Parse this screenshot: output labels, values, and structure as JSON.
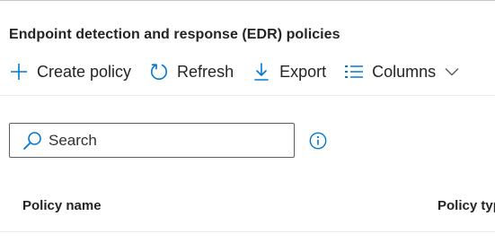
{
  "section": {
    "title": "Endpoint detection and response (EDR) policies"
  },
  "toolbar": {
    "create_label": "Create policy",
    "create_icon": "add-icon",
    "refresh_label": "Refresh",
    "refresh_icon": "refresh-icon",
    "export_label": "Export",
    "export_icon": "download-icon",
    "columns_label": "Columns",
    "columns_icon": "columns-list-icon",
    "columns_chevron_icon": "chevron-down-icon"
  },
  "search": {
    "placeholder": "Search",
    "icon": "search-icon",
    "info_icon": "info-icon"
  },
  "table": {
    "columns": [
      {
        "label": "Policy name"
      },
      {
        "label": "Policy typ"
      }
    ]
  },
  "colors": {
    "accent": "#0078d4",
    "text": "#242424",
    "border": "#605e5c",
    "divider": "#edebe9"
  }
}
